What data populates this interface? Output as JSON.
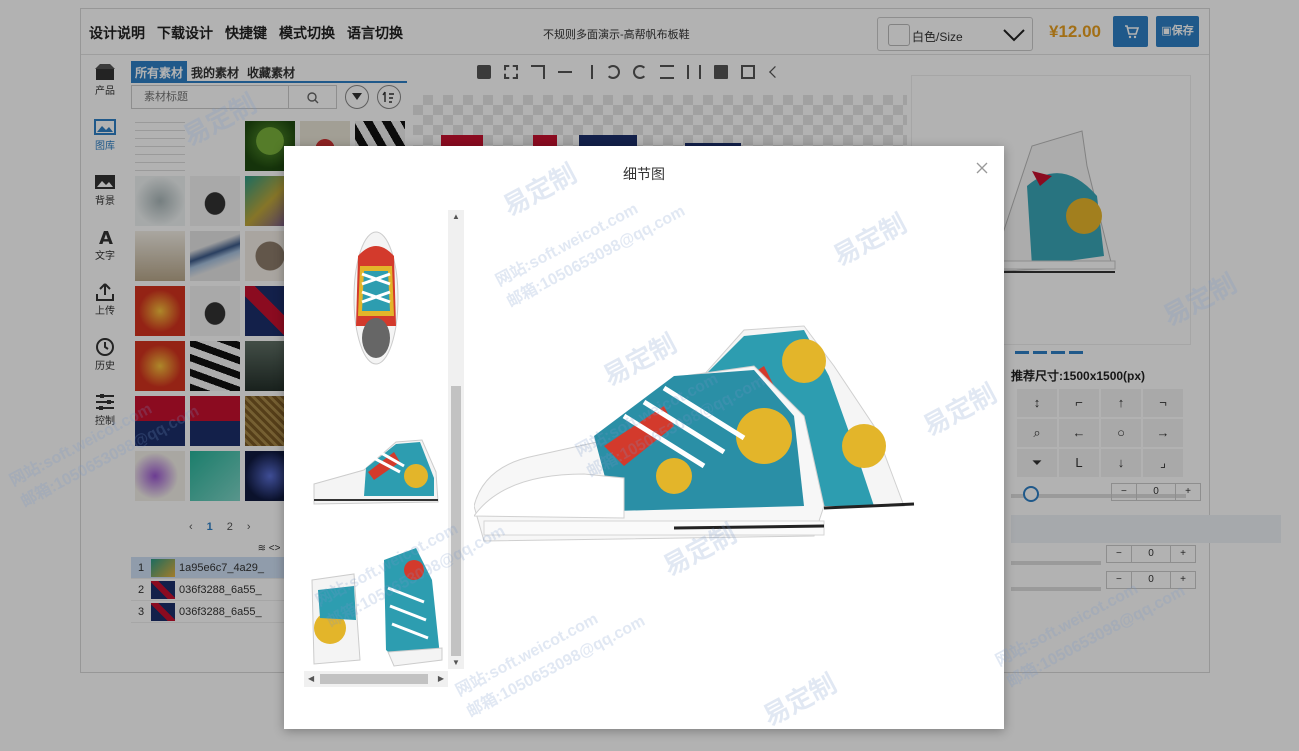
{
  "app": {
    "menu": [
      "设计说明",
      "下载设计",
      "快捷键",
      "模式切换",
      "语言切换"
    ],
    "doc_title": "不规则多面演示-高帮帆布板鞋",
    "variant_label": "白色/Size",
    "price": "¥12.00",
    "save_label": "保存"
  },
  "rail": [
    {
      "label": "产品",
      "icon": "box-icon"
    },
    {
      "label": "图库",
      "icon": "gallery-icon"
    },
    {
      "label": "背景",
      "icon": "background-icon"
    },
    {
      "label": "文字",
      "icon": "text-icon"
    },
    {
      "label": "上传",
      "icon": "upload-icon"
    },
    {
      "label": "历史",
      "icon": "history-icon"
    },
    {
      "label": "控制",
      "icon": "sliders-icon"
    }
  ],
  "materials": {
    "tabs": [
      "所有素材",
      "我的素材",
      "收藏素材"
    ],
    "search_placeholder": "素材标题",
    "pages": [
      "1",
      "2"
    ],
    "layers_header": "<>",
    "layers": [
      {
        "num": "1",
        "name": "1a95e6c7_4a29_"
      },
      {
        "num": "2",
        "name": "036f3288_6a55_"
      },
      {
        "num": "3",
        "name": "036f3288_6a55_"
      }
    ]
  },
  "right_panel": {
    "recommended_size": "推荐尺寸:1500x1500(px)",
    "direction_buttons": [
      "↕",
      "⌐",
      "↑",
      "¬",
      "⌕",
      "←",
      "○",
      "→",
      "⏷",
      "L",
      "↓",
      "⌟"
    ],
    "stepper_values": [
      "0",
      "0",
      "0"
    ]
  },
  "modal": {
    "title": "细节图",
    "thumbnail_count": 3
  },
  "watermark": {
    "brand": "易定制",
    "site": "网站:soft.weicot.com",
    "email": "邮箱:1050653098@qq.com"
  },
  "colors": {
    "accent": "#2f80c6",
    "price": "#e8a020"
  }
}
